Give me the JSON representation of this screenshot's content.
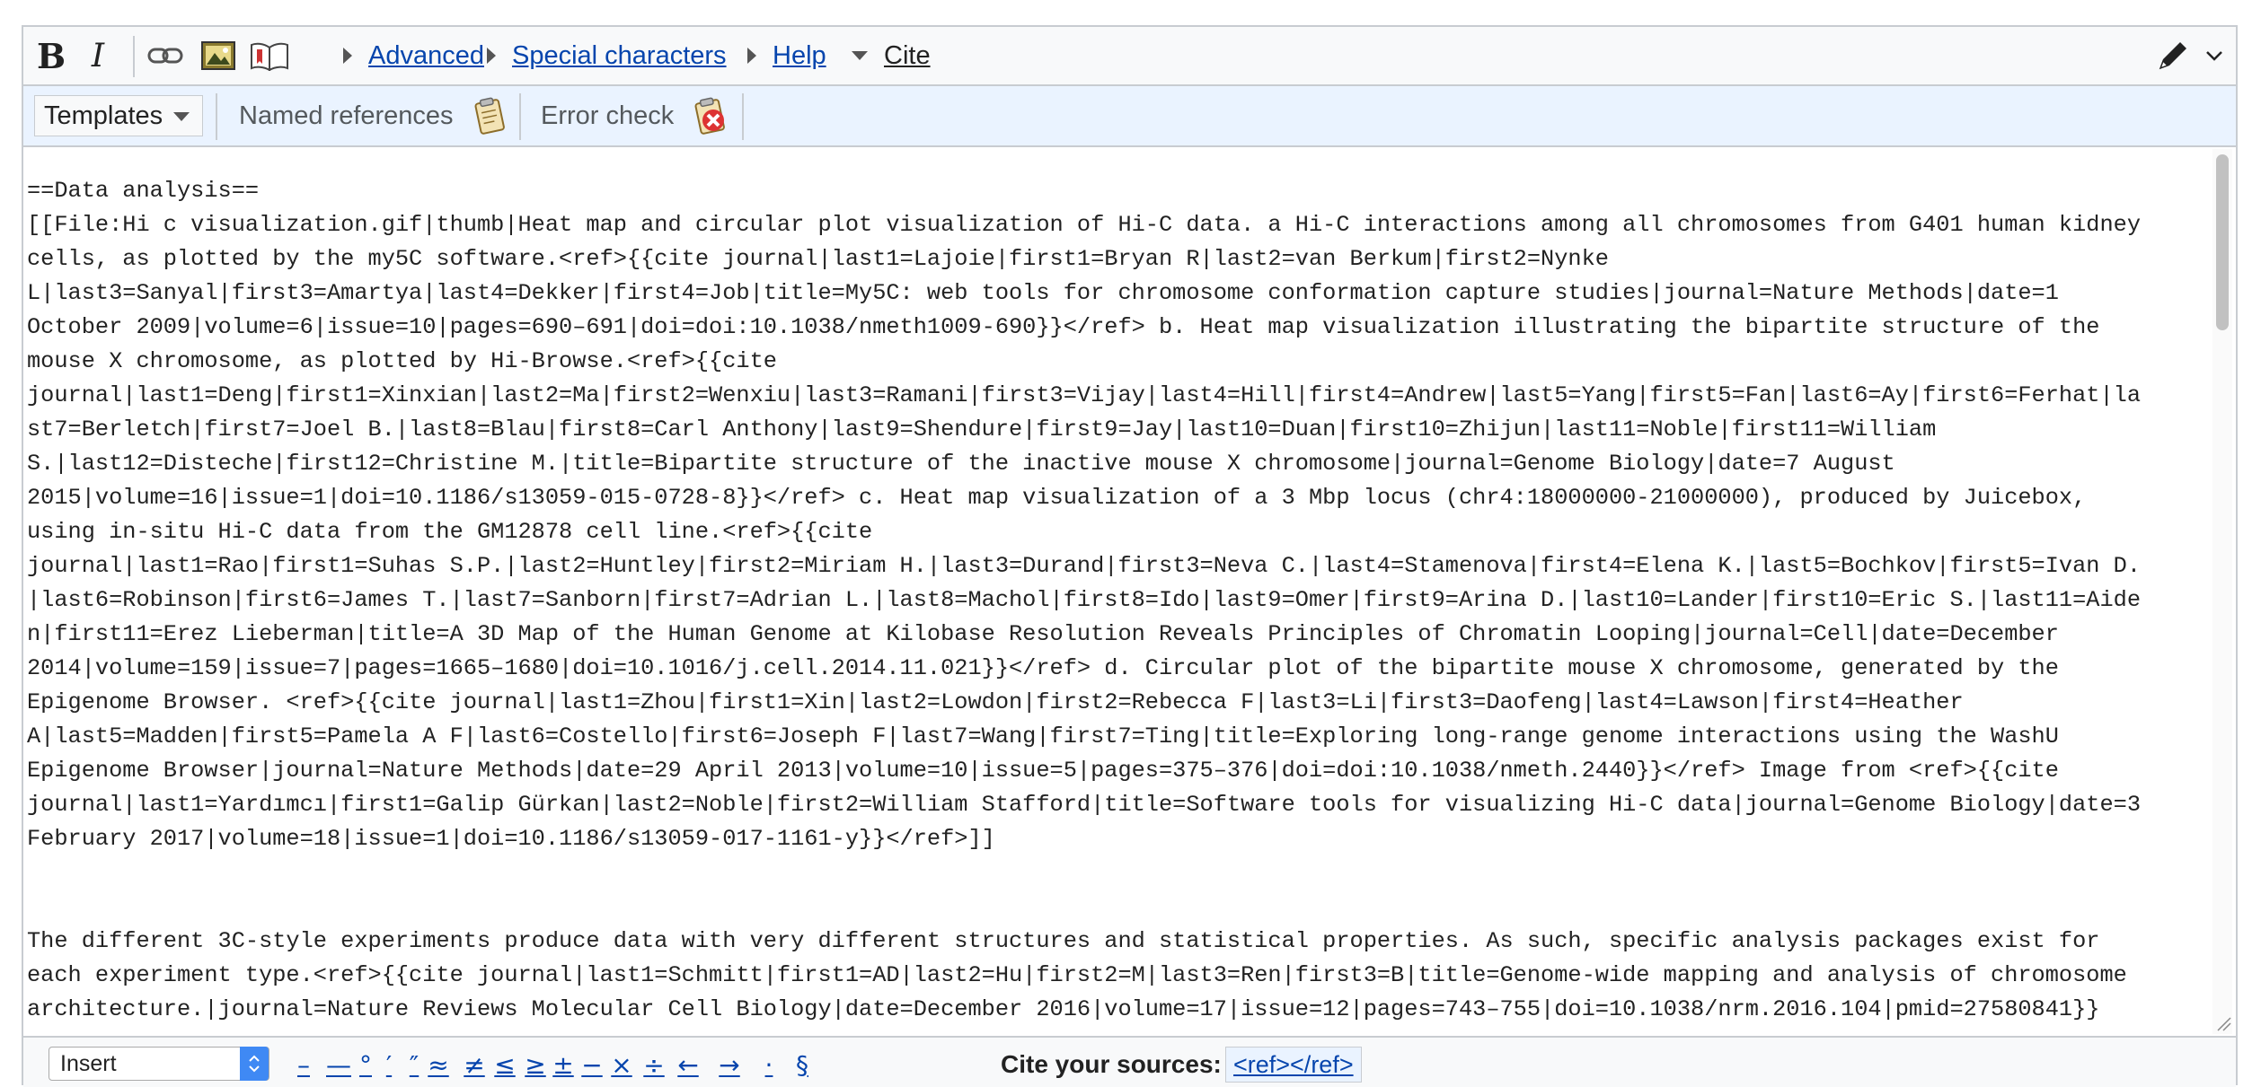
{
  "toolbar": {
    "bold_label": "B",
    "italic_label": "I",
    "link_icon": "link-icon",
    "image_icon": "embedded-file-icon",
    "reference_icon": "reference-book-icon",
    "advanced": "Advanced",
    "special_characters": "Special characters",
    "help": "Help",
    "cite": "Cite",
    "pencil_icon": "pencil-icon"
  },
  "cite_toolbar": {
    "templates": "Templates",
    "named_references": "Named references",
    "error_check": "Error check"
  },
  "editor": {
    "lines": [
      "==Data analysis==",
      "[[File:Hi c visualization.gif|thumb|Heat map and circular plot visualization of Hi-C data. a Hi-C interactions among all chromosomes from G401 human kidney",
      "cells, as plotted by the my5C software.<ref>{{cite journal|last1=Lajoie|first1=Bryan R|last2=van Berkum|first2=Nynke",
      "L|last3=Sanyal|first3=Amartya|last4=Dekker|first4=Job|title=My5C: web tools for chromosome conformation capture studies|journal=Nature Methods|date=1",
      "October 2009|volume=6|issue=10|pages=690–691|doi=doi:10.1038/nmeth1009-690}}</ref> b. Heat map visualization illustrating the bipartite structure of the",
      "mouse X chromosome, as plotted by Hi-Browse.<ref>{{cite",
      "journal|last1=Deng|first1=Xinxian|last2=Ma|first2=Wenxiu|last3=Ramani|first3=Vijay|last4=Hill|first4=Andrew|last5=Yang|first5=Fan|last6=Ay|first6=Ferhat|la",
      "st7=Berletch|first7=Joel B.|last8=Blau|first8=Carl Anthony|last9=Shendure|first9=Jay|last10=Duan|first10=Zhijun|last11=Noble|first11=William",
      "S.|last12=Disteche|first12=Christine M.|title=Bipartite structure of the inactive mouse X chromosome|journal=Genome Biology|date=7 August",
      "2015|volume=16|issue=1|doi=10.1186/s13059-015-0728-8}}</ref> c. Heat map visualization of a 3 Mbp locus (chr4:18000000-21000000), produced by Juicebox,",
      "using in-situ Hi-C data from the GM12878 cell line.<ref>{{cite",
      "journal|last1=Rao|first1=Suhas S.P.|last2=Huntley|first2=Miriam H.|last3=Durand|first3=Neva C.|last4=Stamenova|first4=Elena K.|last5=Bochkov|first5=Ivan D.",
      "|last6=Robinson|first6=James T.|last7=Sanborn|first7=Adrian L.|last8=Machol|first8=Ido|last9=Omer|first9=Arina D.|last10=Lander|first10=Eric S.|last11=Aide",
      "n|first11=Erez Lieberman|title=A 3D Map of the Human Genome at Kilobase Resolution Reveals Principles of Chromatin Looping|journal=Cell|date=December",
      "2014|volume=159|issue=7|pages=1665–1680|doi=10.1016/j.cell.2014.11.021}}</ref> d. Circular plot of the bipartite mouse X chromosome, generated by the",
      "Epigenome Browser. <ref>{{cite journal|last1=Zhou|first1=Xin|last2=Lowdon|first2=Rebecca F|last3=Li|first3=Daofeng|last4=Lawson|first4=Heather",
      "A|last5=Madden|first5=Pamela A F|last6=Costello|first6=Joseph F|last7=Wang|first7=Ting|title=Exploring long-range genome interactions using the WashU",
      "Epigenome Browser|journal=Nature Methods|date=29 April 2013|volume=10|issue=5|pages=375–376|doi=doi:10.1038/nmeth.2440}}</ref> Image from <ref>{{cite",
      "journal|last1=Yardımcı|first1=Galip Gürkan|last2=Noble|first2=William Stafford|title=Software tools for visualizing Hi-C data|journal=Genome Biology|date=3",
      "February 2017|volume=18|issue=1|doi=10.1186/s13059-017-1161-y}}</ref>]]",
      "",
      "",
      "The different 3C-style experiments produce data with very different structures and statistical properties. As such, specific analysis packages exist for",
      "each experiment type.<ref>{{cite journal|last1=Schmitt|first1=AD|last2=Hu|first2=M|last3=Ren|first3=B|title=Genome-wide mapping and analysis of chromosome",
      "architecture.|journal=Nature Reviews Molecular Cell Biology|date=December 2016|volume=17|issue=12|pages=743–755|doi=10.1038/nrm.2016.104|pmid=27580841}}"
    ]
  },
  "insert_bar": {
    "select_value": "Insert",
    "symbols": [
      "–",
      "—",
      "°",
      "′",
      "″",
      "≈",
      "≠",
      "≤",
      "≥",
      "±",
      "−",
      "×",
      "÷",
      "←",
      "→",
      "·",
      "§"
    ],
    "cite_label": "Cite your sources:",
    "cite_ref": "<ref></ref>"
  }
}
